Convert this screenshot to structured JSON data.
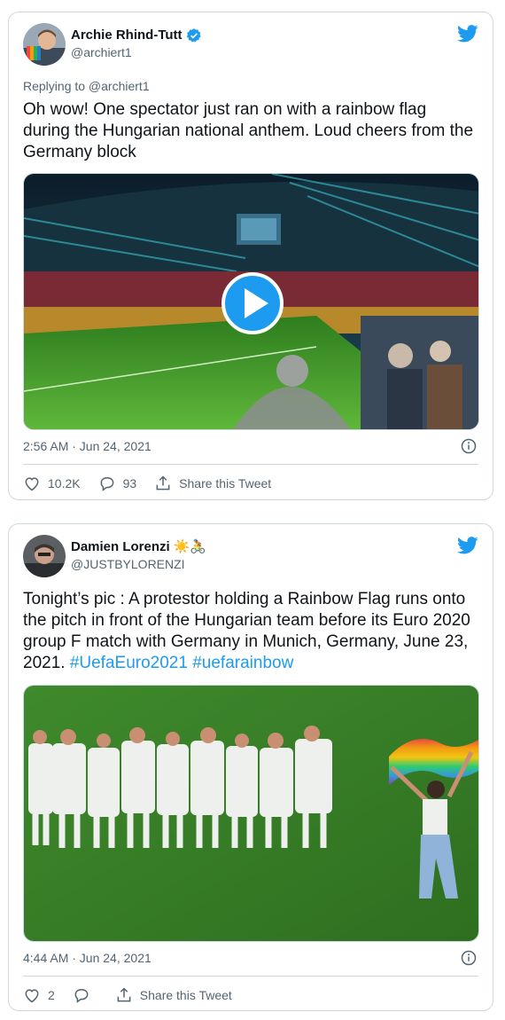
{
  "tweets": [
    {
      "author": "Archie Rhind-Tutt",
      "handle": "@archiert1",
      "verified": true,
      "replying_to": "Replying to @archiert1",
      "text": "Oh wow! One spectator just ran on with a rainbow flag during the Hungarian national anthem. Loud cheers from the Germany block",
      "media_type": "video",
      "timestamp": "2:56 AM · Jun 24, 2021",
      "likes": "10.2K",
      "replies": "93",
      "share_label": "Share this Tweet"
    },
    {
      "author": "Damien Lorenzi",
      "author_emoji": "☀️🚴",
      "handle": "@JUSTBYLORENZI",
      "verified": false,
      "text_plain": "Tonight’s pic : A protestor holding a Rainbow Flag runs onto the pitch in front of the Hungarian team before its Euro 2020 group F match with Germany in Munich, Germany, June 23, 2021.",
      "hashtags": [
        "#UefaEuro2021",
        "#uefarainbow"
      ],
      "media_type": "photo",
      "timestamp": "4:44 AM · Jun 24, 2021",
      "likes": "2",
      "replies": "",
      "share_label": "Share this Tweet"
    }
  ],
  "colors": {
    "twitter_blue": "#1d9bf0",
    "secondary_text": "#536471",
    "border": "#cfd9de"
  },
  "icons": [
    "verified-badge-icon",
    "twitter-bird-icon",
    "play-icon",
    "info-icon",
    "heart-icon",
    "reply-icon",
    "share-icon"
  ]
}
